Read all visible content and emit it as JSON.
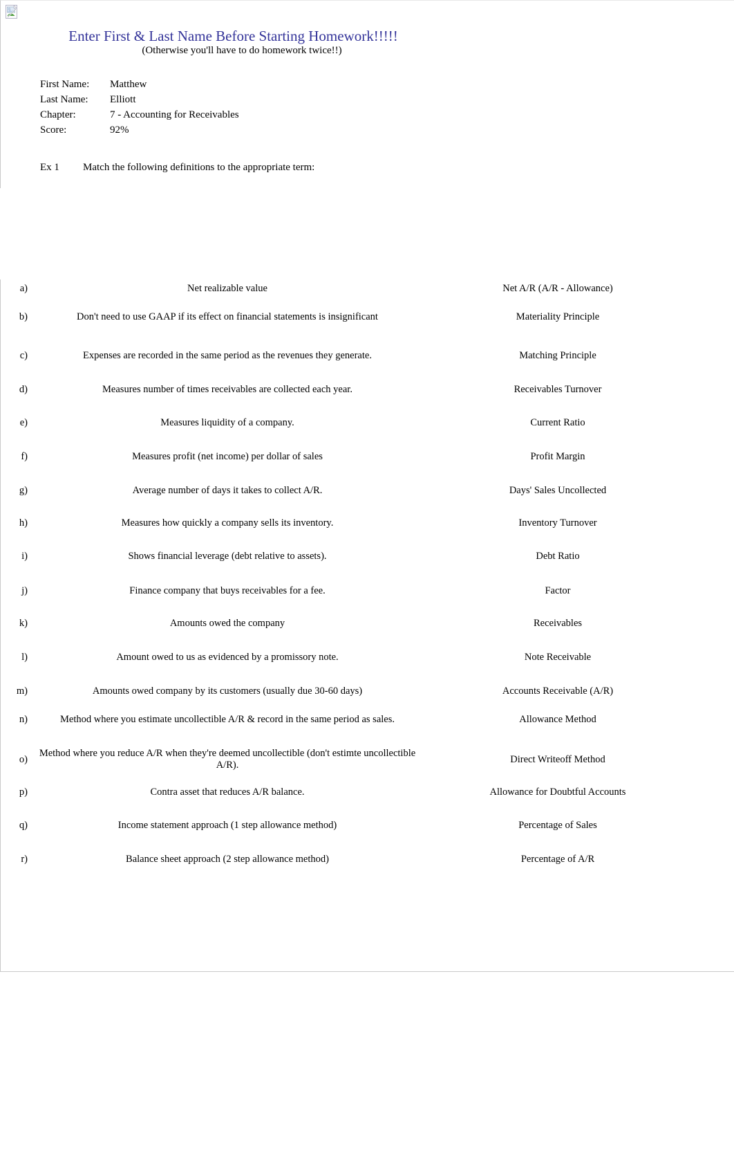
{
  "document": {
    "icon": "broken-image-icon",
    "title": "Enter First & Last Name Before Starting Homework!!!!!",
    "subtitle": "(Otherwise you'll have to do homework twice!!)",
    "title_color": "#333399"
  },
  "info": {
    "rows": [
      {
        "label": "First Name:",
        "value": "Matthew"
      },
      {
        "label": "Last Name:",
        "value": "Elliott"
      },
      {
        "label": "Chapter:",
        "value": "7 - Accounting for Receivables"
      },
      {
        "label": "Score:",
        "value": "92%"
      }
    ]
  },
  "exercise": {
    "number": "Ex 1",
    "instruction": "Match the following definitions to the appropriate term:"
  },
  "matching": {
    "rows": [
      {
        "letter": "a)",
        "definition": "Net realizable value",
        "term": "Net A/R (A/R - Allowance)"
      },
      {
        "letter": "b)",
        "definition": "Don't need to use GAAP if its effect on financial statements is insignificant",
        "term": "Materiality Principle"
      },
      {
        "letter": "c)",
        "definition": "Expenses are recorded in the same period as the revenues they generate.",
        "term": "Matching Principle"
      },
      {
        "letter": "d)",
        "definition": "Measures number of times receivables are collected each    year.",
        "term": "Receivables Turnover"
      },
      {
        "letter": "e)",
        "definition": "Measures liquidity of a company.",
        "term": "Current Ratio"
      },
      {
        "letter": "f)",
        "definition": "Measures profit (net income) per dollar of sales",
        "term": "Profit Margin"
      },
      {
        "letter": "g)",
        "definition": "Average number of days it takes to collect A/R.",
        "term": "Days' Sales Uncollected"
      },
      {
        "letter": "h)",
        "definition": "Measures how quickly a company sells its inventory.",
        "term": "Inventory Turnover"
      },
      {
        "letter": "i)",
        "definition": "Shows financial leverage (debt relative to assets).",
        "term": "Debt Ratio"
      },
      {
        "letter": "j)",
        "definition": "Finance company that buys receivables for a fee.",
        "term": "Factor"
      },
      {
        "letter": "k)",
        "definition": "Amounts owed the company",
        "term": "Receivables"
      },
      {
        "letter": "l)",
        "definition": "Amount owed to us as evidenced by a promissory note.",
        "term": "Note Receivable"
      },
      {
        "letter": "m)",
        "definition": "Amounts owed company by its customers (usually due 30-60 days)",
        "term": "Accounts Receivable (A/R)"
      },
      {
        "letter": "n)",
        "definition": "Method where you estimate uncollectible A/R & record in the same period as sales.",
        "term": "Allowance Method"
      },
      {
        "letter": "o)",
        "definition": "Method where you reduce A/R when they're deemed uncollectible (don't estimte uncollectible A/R).",
        "term": "Direct Writeoff Method"
      },
      {
        "letter": "p)",
        "definition": "Contra asset that reduces A/R balance.",
        "term": "Allowance for Doubtful Accounts"
      },
      {
        "letter": "q)",
        "definition": "Income statement approach (1 step allowance method)",
        "term": "Percentage of Sales"
      },
      {
        "letter": "r)",
        "definition": "Balance sheet approach (2 step allowance method)",
        "term": "Percentage of A/R"
      }
    ]
  }
}
